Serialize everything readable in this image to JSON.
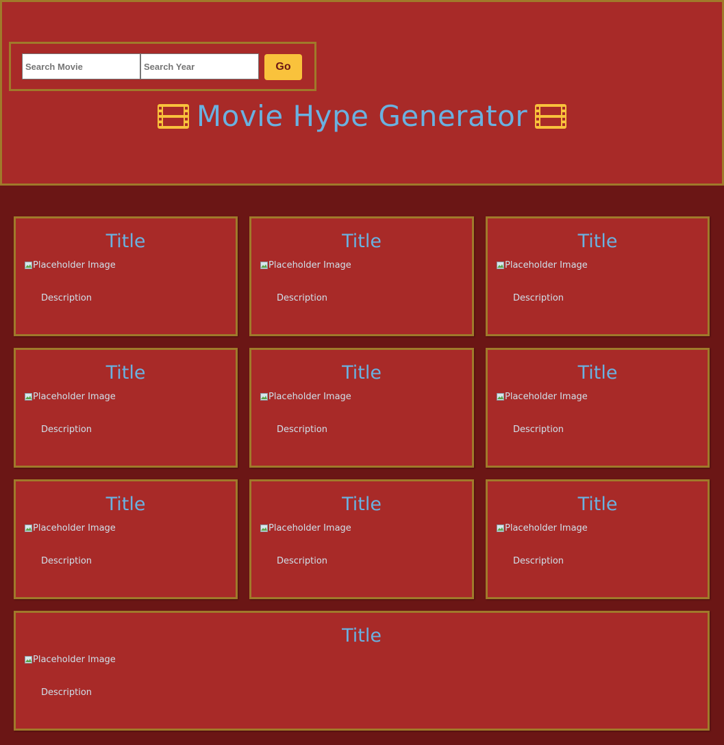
{
  "search": {
    "movie_placeholder": "Search Movie",
    "year_placeholder": "Search Year",
    "go_label": "Go"
  },
  "header": {
    "title": "Movie Hype Generator",
    "title_icon": "film-strip-icon",
    "title_color": "#6ab1e0",
    "accent_color": "#f9c23c"
  },
  "colors": {
    "page_background": "#6b1615",
    "panel_background": "#a82a28",
    "border": "#a07a2a"
  },
  "cards": [
    {
      "title": "Title",
      "image_alt": "Placeholder Image",
      "description": "Description"
    },
    {
      "title": "Title",
      "image_alt": "Placeholder Image",
      "description": "Description"
    },
    {
      "title": "Title",
      "image_alt": "Placeholder Image",
      "description": "Description"
    },
    {
      "title": "Title",
      "image_alt": "Placeholder Image",
      "description": "Description"
    },
    {
      "title": "Title",
      "image_alt": "Placeholder Image",
      "description": "Description"
    },
    {
      "title": "Title",
      "image_alt": "Placeholder Image",
      "description": "Description"
    },
    {
      "title": "Title",
      "image_alt": "Placeholder Image",
      "description": "Description"
    },
    {
      "title": "Title",
      "image_alt": "Placeholder Image",
      "description": "Description"
    },
    {
      "title": "Title",
      "image_alt": "Placeholder Image",
      "description": "Description"
    },
    {
      "title": "Title",
      "image_alt": "Placeholder Image",
      "description": "Description"
    }
  ]
}
